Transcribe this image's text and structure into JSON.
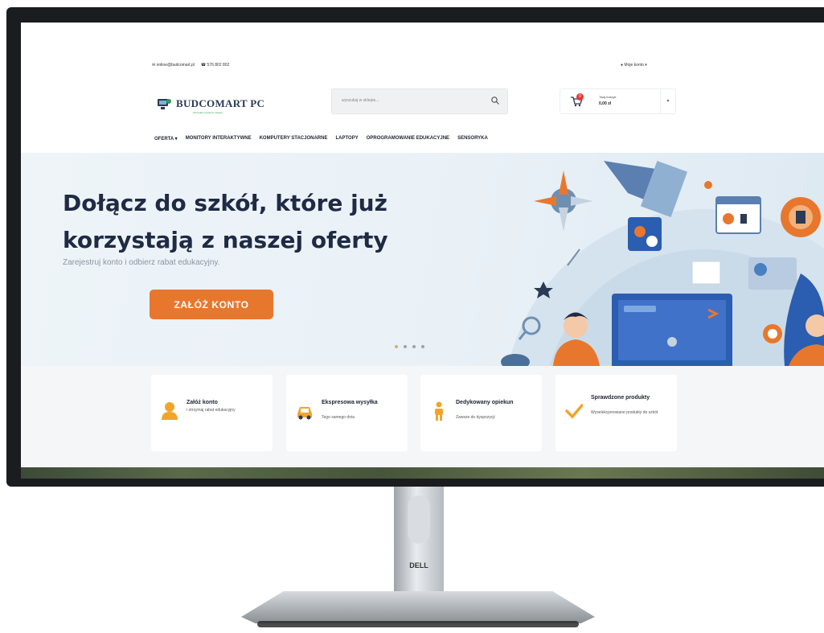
{
  "topbar": {
    "email": "online@budcomart.pl",
    "phone": "576 802 802",
    "account": "Moje konto"
  },
  "header": {
    "logo_name": "BUDCOMART PC",
    "logo_tagline": "Wszystko w jednym miejscu",
    "search_placeholder": "wyszukaj w sklepie...",
    "cart_label": "Twój koszyk",
    "cart_total": "0,00 zł",
    "cart_count": "0"
  },
  "nav": {
    "items": [
      "OFERTA",
      "MONITORY INTERAKTYWNE",
      "KOMPUTERY STACJONARNE",
      "LAPTOPY",
      "OPROGRAMOWANIE EDUKACYJNE",
      "SENSORYKA"
    ]
  },
  "hero": {
    "title_line1": "Dołącz do szkół, które już",
    "title_line2": "korzystają z naszej oferty",
    "subtitle": "Zarejestruj konto i odbierz rabat edukacyjny.",
    "cta": "ZAŁÓŻ KONTO",
    "slides": 4,
    "active_slide": 1
  },
  "features": [
    {
      "title": "Załóż konto",
      "text": "i otrzymaj rabat edukacyjny",
      "icon": "user-icon"
    },
    {
      "title": "Ekspresowa wysyłka",
      "text": "Tego samego dnia",
      "icon": "car-icon"
    },
    {
      "title": "Dedykowany opiekun",
      "text": "Zawsze do dyspozycji",
      "icon": "person-icon"
    },
    {
      "title": "Sprawdzone produkty",
      "text": "Wyselekcjonowane produkty do szkół",
      "icon": "check-icon"
    }
  ],
  "monitor": {
    "brand": "DELL"
  },
  "colors": {
    "accent": "#e8772e",
    "title": "#1f2a44",
    "hero_bg": "#eaf2f8"
  }
}
